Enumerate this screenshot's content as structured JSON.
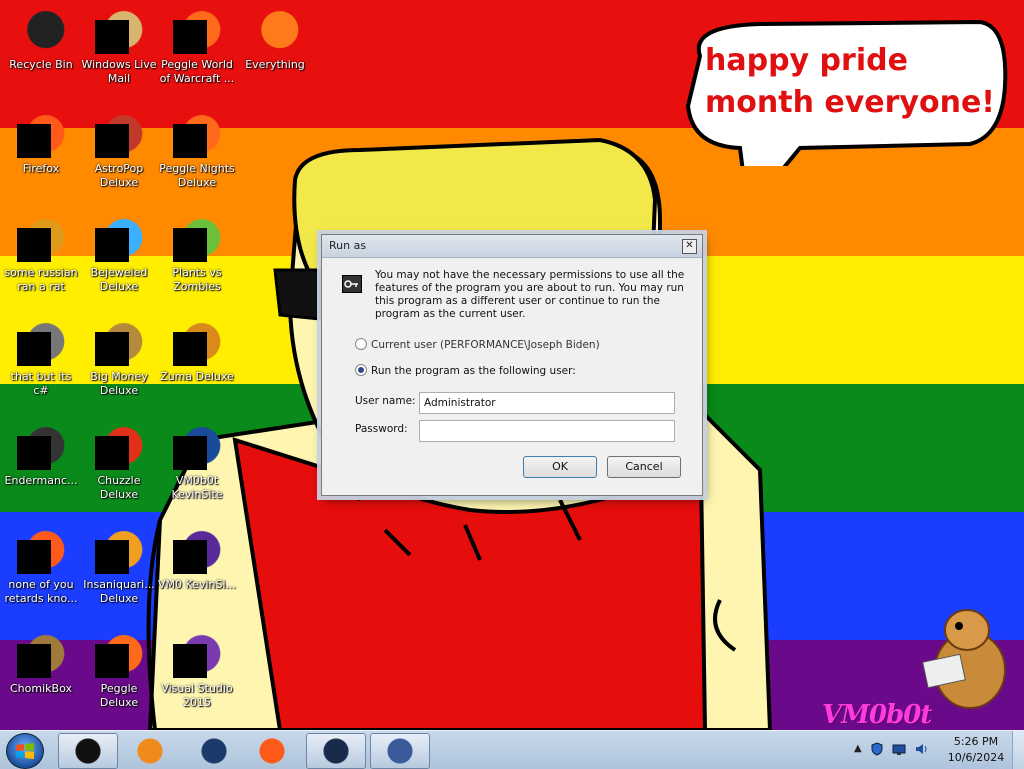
{
  "wallpaper": {
    "speech_text": "happy pride month everyone!",
    "watermark": "VM0b0t"
  },
  "desktop_icons": [
    {
      "label": "Recycle Bin",
      "icon": "recycle-bin-icon"
    },
    {
      "label": "Windows Live Mail",
      "icon": "mail-icon"
    },
    {
      "label": "Peggle World of Warcraft ...",
      "icon": "peggle-icon"
    },
    {
      "label": "Everything",
      "icon": "search-icon"
    },
    {
      "label": "Firefox",
      "icon": "firefox-icon"
    },
    {
      "label": "AstroPop Deluxe",
      "icon": "game-icon"
    },
    {
      "label": "Peggle Nights Deluxe",
      "icon": "peggle-icon"
    },
    {
      "label": "some russian ran a rat",
      "icon": "app-icon"
    },
    {
      "label": "Bejeweled Deluxe",
      "icon": "gem-icon"
    },
    {
      "label": "Plants vs Zombies",
      "icon": "plant-icon"
    },
    {
      "label": "that but its c#",
      "icon": "window-icon"
    },
    {
      "label": "Big Money Deluxe",
      "icon": "money-bag-icon"
    },
    {
      "label": "Zuma Deluxe",
      "icon": "zuma-icon"
    },
    {
      "label": "Endermanc...",
      "icon": "terminal-icon"
    },
    {
      "label": "Chuzzle Deluxe",
      "icon": "chuzzle-icon"
    },
    {
      "label": "VM0b0t KevinSite",
      "icon": "monitor-icon"
    },
    {
      "label": "none of you retards kno...",
      "icon": "firefox-icon"
    },
    {
      "label": "Insaniquari... Deluxe",
      "icon": "fish-icon"
    },
    {
      "label": "VM0 KevinSi...",
      "icon": "file-icon"
    },
    {
      "label": "ChomikBox",
      "icon": "chomikbox-icon"
    },
    {
      "label": "Peggle Deluxe",
      "icon": "peggle-icon"
    },
    {
      "label": "Visual Studio 2015",
      "icon": "visual-studio-icon"
    }
  ],
  "dialog": {
    "title": "Run as",
    "close_glyph": "✕",
    "message": "You may not have the necessary permissions to use all the features of the program you are about to run. You may run this program as a different user or continue to run the program as the current user.",
    "option_current": "Current user (PERFORMANCE\\Joseph Biden)",
    "option_other": "Run the program as the following user:",
    "selected_option": "other",
    "username_label": "User name:",
    "username_value": "Administrator",
    "password_label": "Password:",
    "password_value": "",
    "ok_label": "OK",
    "cancel_label": "Cancel"
  },
  "taskbar": {
    "items": [
      {
        "icon": "black-box-icon",
        "active": true
      },
      {
        "icon": "media-player-icon",
        "active": false
      },
      {
        "icon": "globe-icon",
        "active": false
      },
      {
        "icon": "firefox-icon",
        "active": false
      },
      {
        "icon": "monitor-icon",
        "active": true
      },
      {
        "icon": "run-as-icon",
        "active": true
      }
    ],
    "clock_time": "5:26 PM",
    "clock_date": "10/6/2024",
    "tray_chevron": "▲"
  },
  "colors": {
    "red": "#e80f0f",
    "orange": "#ff8a00",
    "yellow": "#ffee00",
    "green": "#0a8a1a",
    "blue": "#1a3dff",
    "purple": "#6a0a8a",
    "speech_text": "#e01010",
    "watermark": "#ff3be0"
  }
}
